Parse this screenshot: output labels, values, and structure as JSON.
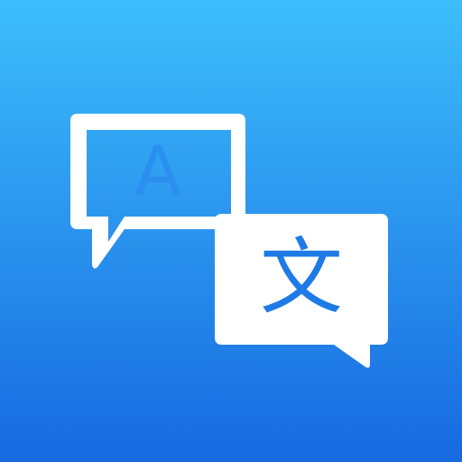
{
  "app_icon": {
    "icon": "translate-icon",
    "source_bubble": {
      "icon": "speech-bubble-outline-icon",
      "letter": "A"
    },
    "target_bubble": {
      "icon": "speech-bubble-filled-icon",
      "letter": "文"
    }
  },
  "colors": {
    "background_top": "#3DBEFB",
    "background_mid": "#2A8FF0",
    "background_bottom": "#1769E0",
    "bubble": "#FFFFFF",
    "accent": "#1E7AE6"
  }
}
